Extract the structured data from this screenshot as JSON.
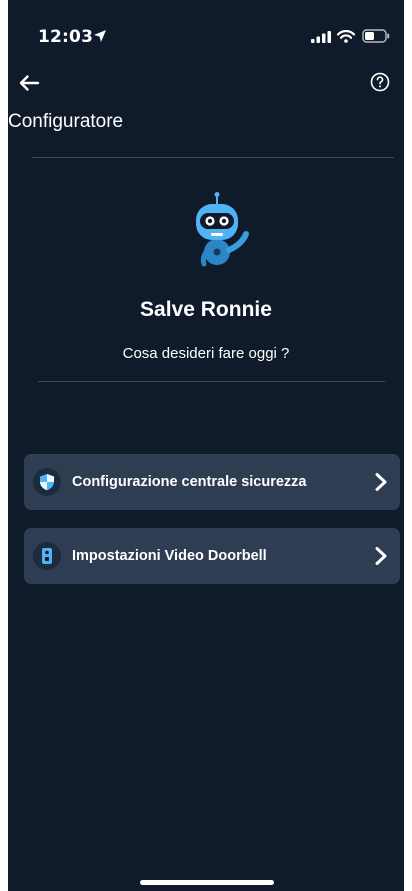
{
  "status_bar": {
    "time": "12:03"
  },
  "header": {
    "title": "Configuratore",
    "back_icon": "arrow-left-icon",
    "help_icon": "help-circle-icon"
  },
  "greeting": {
    "title": "Salve Ronnie",
    "subtitle": "Cosa desideri fare oggi ?",
    "mascot_icon": "robot-mascot-icon"
  },
  "menu": {
    "items": [
      {
        "label": "Configurazione centrale sicurezza",
        "icon": "shield-icon"
      },
      {
        "label": "Impostazioni Video Doorbell",
        "icon": "doorbell-icon"
      }
    ]
  },
  "colors": {
    "background": "#0f1b2a",
    "card": "#2e3d52",
    "accent": "#4fb3f5"
  }
}
